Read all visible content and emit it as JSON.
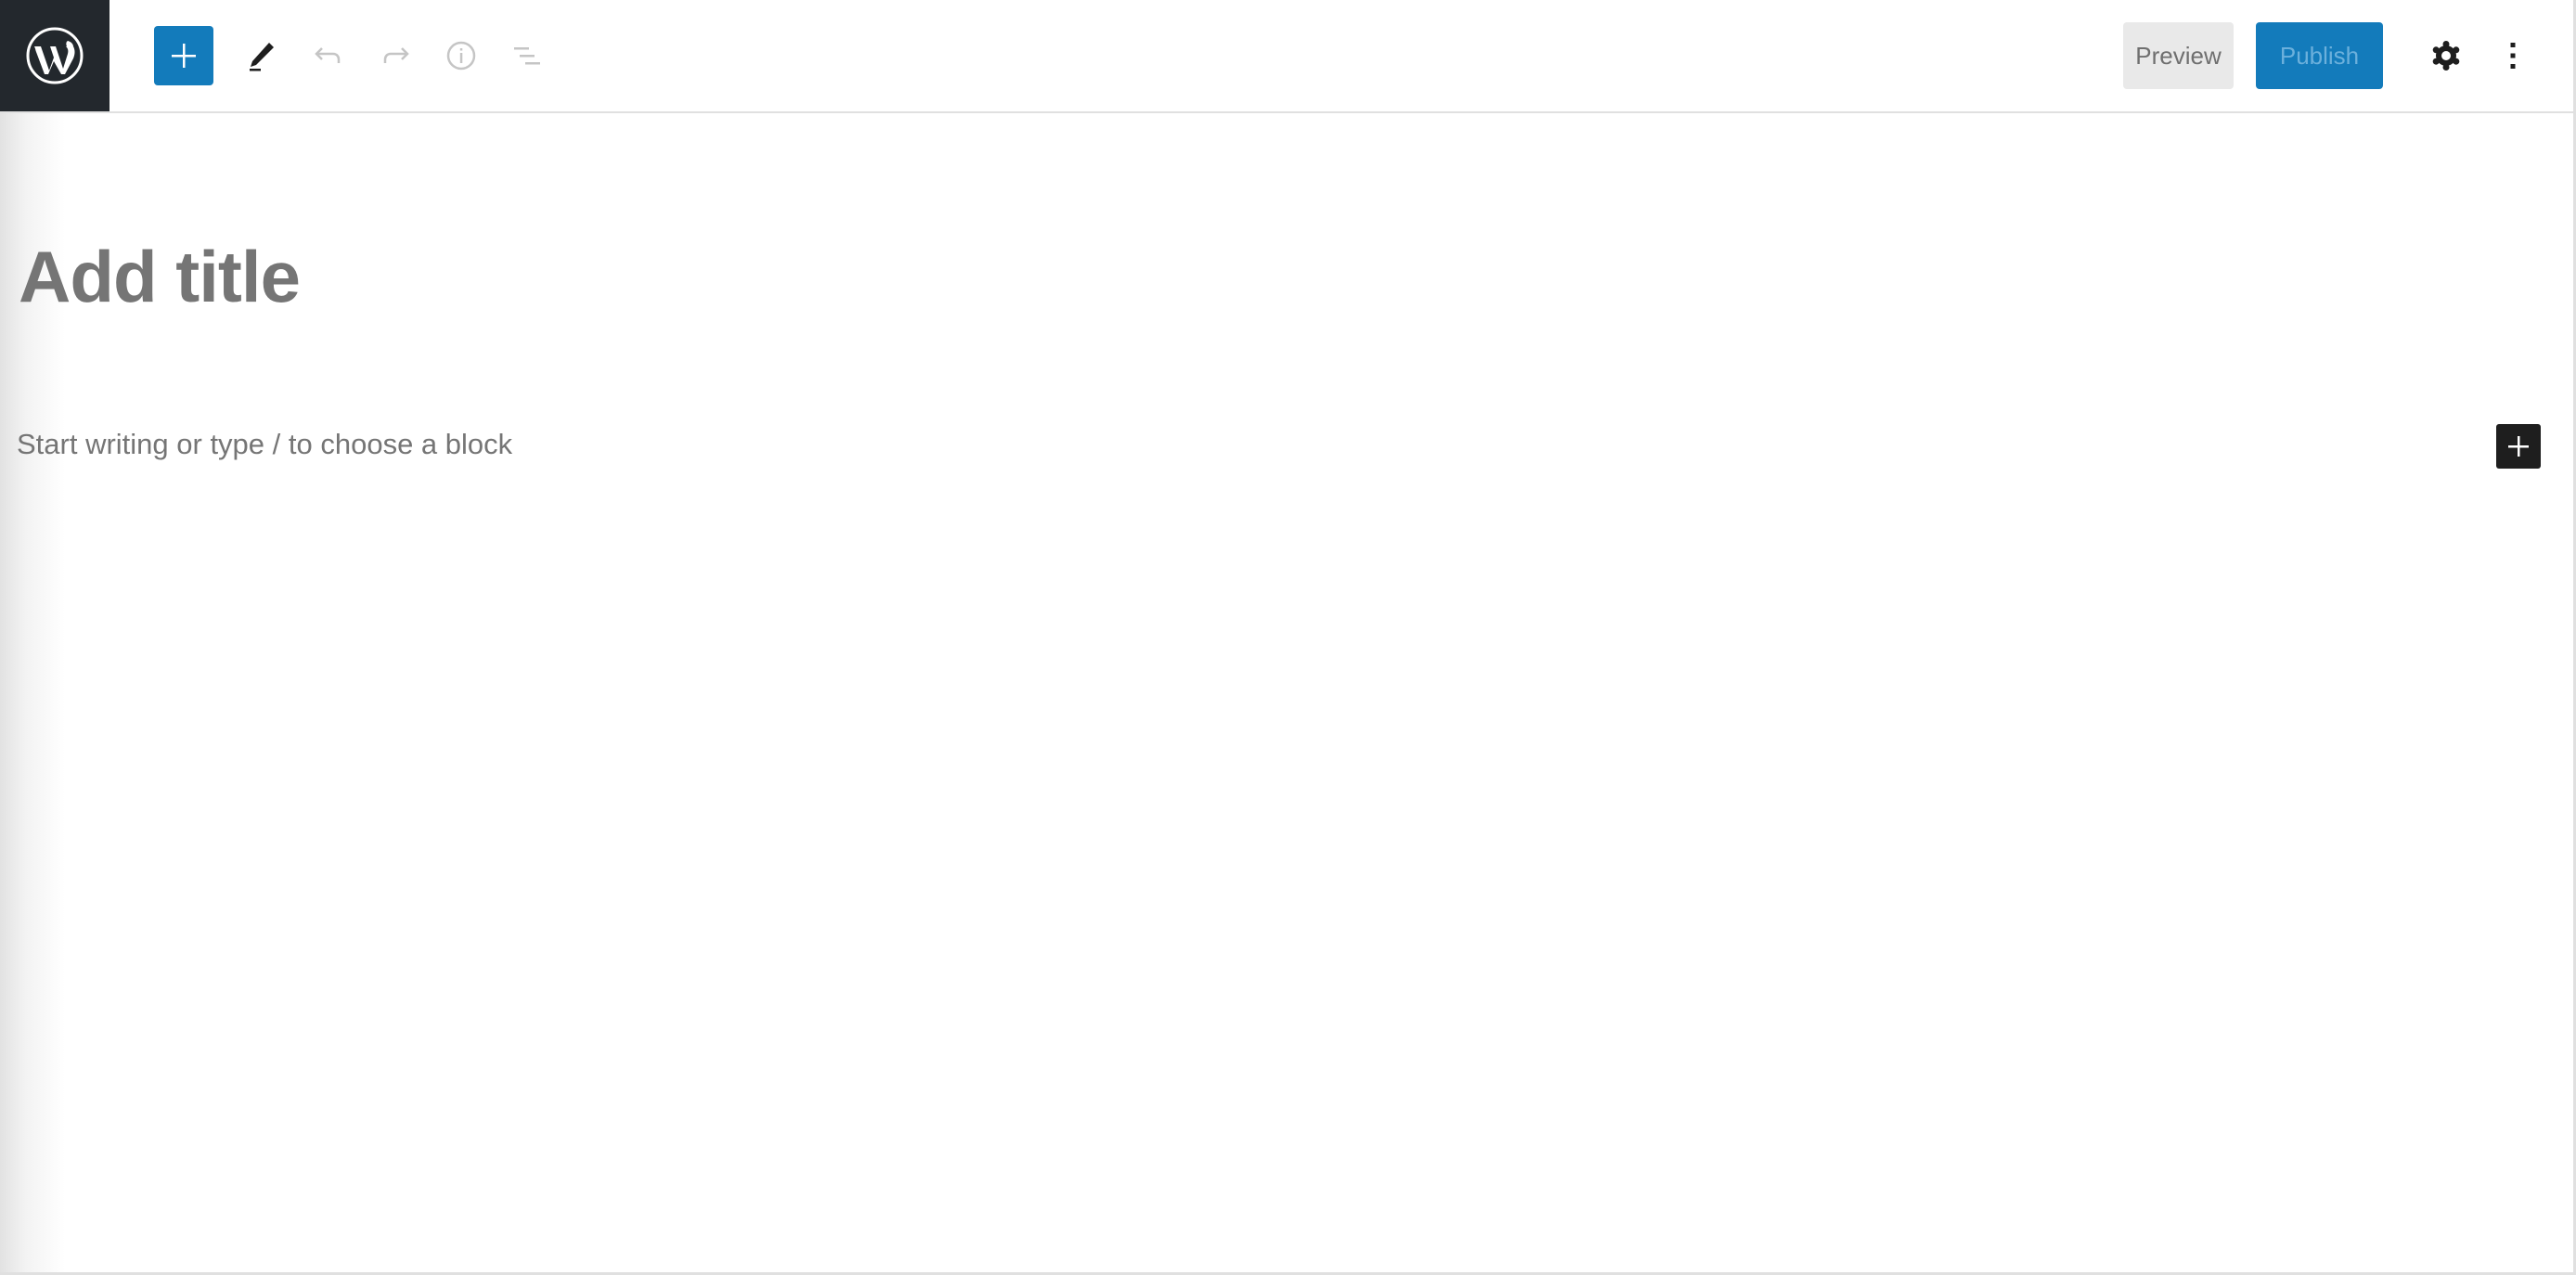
{
  "header": {
    "logo": {
      "icon": "wordpress-logo-icon",
      "label": "WordPress"
    },
    "toolbar": {
      "add_block": {
        "icon": "plus-icon",
        "label": "Toggle block inserter"
      },
      "tools": {
        "icon": "pencil-icon",
        "label": "Tools"
      },
      "undo": {
        "icon": "undo-icon",
        "label": "Undo"
      },
      "redo": {
        "icon": "redo-icon",
        "label": "Redo"
      },
      "details": {
        "icon": "info-icon",
        "label": "Details"
      },
      "list_view": {
        "icon": "list-view-icon",
        "label": "List View"
      }
    },
    "actions": {
      "preview_label": "Preview",
      "publish_label": "Publish",
      "settings": {
        "icon": "gear-icon",
        "label": "Settings"
      },
      "options": {
        "icon": "more-vertical-icon",
        "label": "Options"
      }
    }
  },
  "editor": {
    "title_placeholder": "Add title",
    "block_placeholder": "Start writing or type / to choose a block",
    "block_inserter": {
      "icon": "plus-icon",
      "label": "Add block"
    }
  },
  "colors": {
    "accent": "#137bbb",
    "logo_background": "#23282d",
    "placeholder_text": "#757575",
    "inserter_dark": "#1e1e1e"
  }
}
